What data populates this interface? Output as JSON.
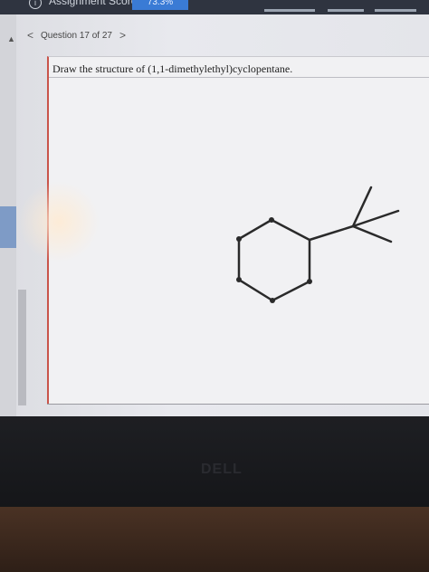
{
  "header": {
    "score_label": "Assignment Score:",
    "score_value": "73.3%"
  },
  "nav": {
    "prev_glyph": "<",
    "question_label": "Question 17 of 27",
    "next_glyph": ">"
  },
  "question": {
    "prompt": "Draw the structure of (1,1-dimethylethyl)cyclopentane."
  },
  "bezel": {
    "brand": "DELL"
  },
  "icons": [
    "info-icon",
    "chevron-left-icon",
    "chevron-right-icon"
  ],
  "colors": {
    "topbar": "#2f3440",
    "accent": "#3a7bd5",
    "content_border": "#c9544a"
  }
}
